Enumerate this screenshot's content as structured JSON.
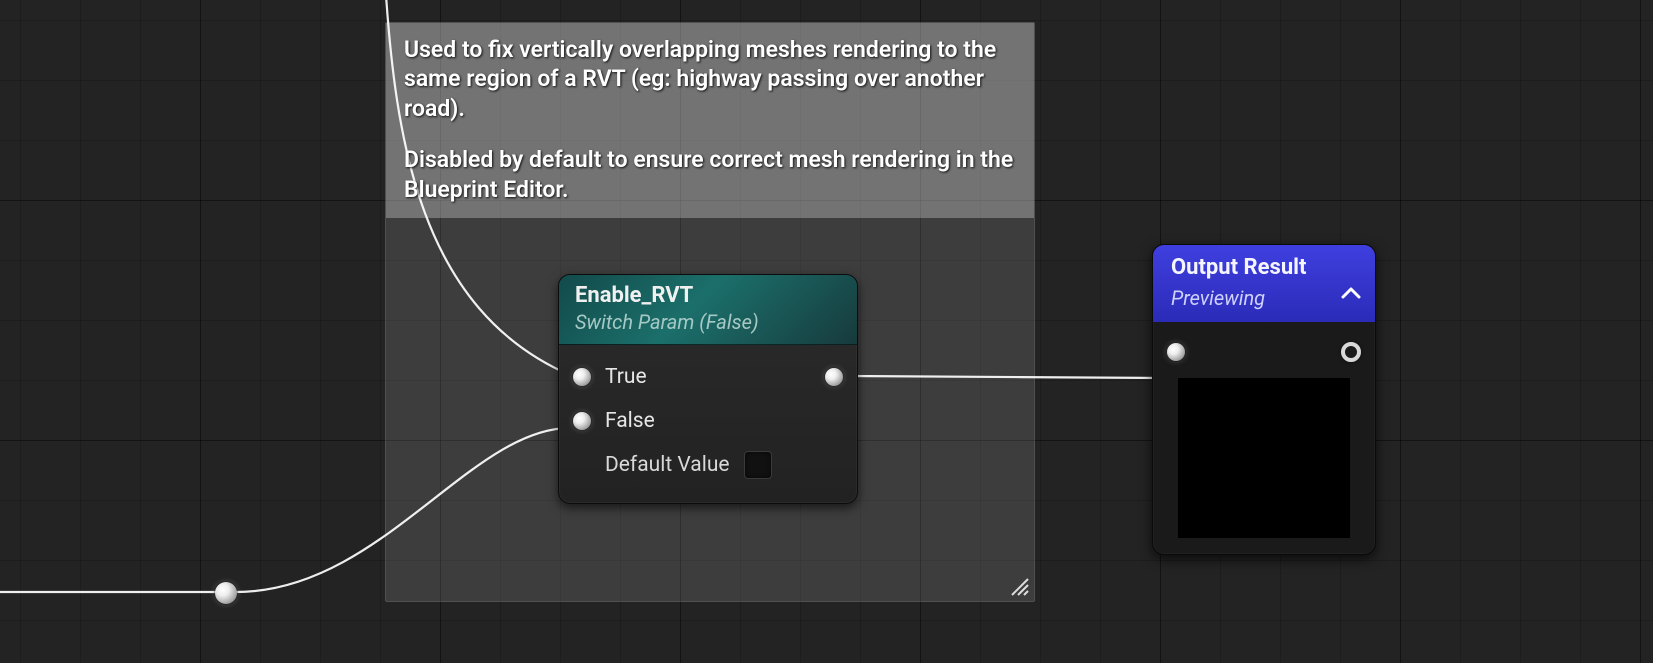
{
  "comment": {
    "paragraph1": "Used to fix vertically overlapping meshes rendering to the same region of a RVT (eg: highway passing over another road).",
    "paragraph2": "Disabled by default to ensure correct mesh rendering in the Blueprint Editor."
  },
  "switch_node": {
    "title": "Enable_RVT",
    "subtitle": "Switch Param (False)",
    "pins": {
      "true_label": "True",
      "false_label": "False",
      "default_label": "Default Value",
      "default_checked": false
    }
  },
  "output_node": {
    "title": "Output Result",
    "subtitle": "Previewing"
  },
  "icons": {
    "chevron_up": "chevron-up-icon",
    "resize": "resize-handle-icon"
  }
}
